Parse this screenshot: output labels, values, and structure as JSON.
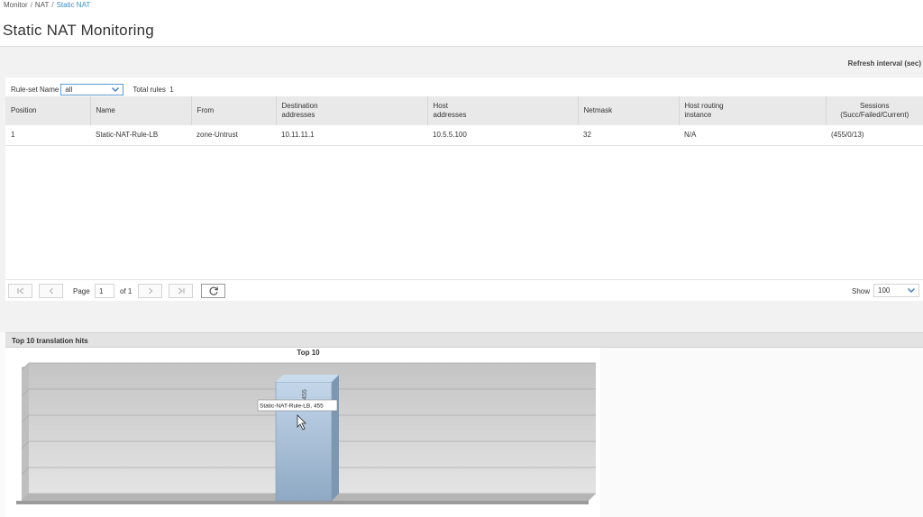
{
  "breadcrumb": {
    "items": [
      "Monitor",
      "NAT"
    ],
    "current": "Static NAT",
    "separator": "/"
  },
  "page_title": "Static NAT Monitoring",
  "refresh_interval_label": "Refresh interval (sec)",
  "filter": {
    "rule_set_label": "Rule-set Name",
    "rule_set_value": "all",
    "total_rules_label": "Total rules",
    "total_rules_value": "1"
  },
  "table": {
    "headers": {
      "position": "Position",
      "name": "Name",
      "from": "From",
      "destination_1": "Destination",
      "destination_2": "addresses",
      "host_1": "Host",
      "host_2": "addresses",
      "netmask": "Netmask",
      "routing_1": "Host routing",
      "routing_2": "instance",
      "sessions_1": "Sessions",
      "sessions_2": "(Succ/Failed/Current)"
    },
    "rows": [
      {
        "position": "1",
        "name": "Static-NAT-Rule-LB",
        "from": "zone-Untrust",
        "destination": "10.11.11.1",
        "host": "10.5.5.100",
        "netmask": "32",
        "routing": "N/A",
        "sessions": "(455/0/13)"
      }
    ]
  },
  "pager": {
    "page_label": "Page",
    "page_value": "1",
    "of_label": "of 1",
    "show_label": "Show",
    "show_value": "100"
  },
  "chart_section": {
    "header": "Top 10 translation hits"
  },
  "chart_data": {
    "type": "bar",
    "title": "Top 10",
    "categories": [
      "Static-NAT-Rule-LB"
    ],
    "values": [
      455
    ],
    "data_labels": [
      "455"
    ],
    "tooltip": "Static-NAT-Rule-LB, 455",
    "ylim": [
      0,
      500
    ],
    "grid": true,
    "colors": {
      "bar": "#a9c3dc",
      "bar_side": "#7d97b1",
      "bar_top": "#c9dcee",
      "plot_bg": "#d3d3d3",
      "floor": "#b5b5b5"
    }
  }
}
